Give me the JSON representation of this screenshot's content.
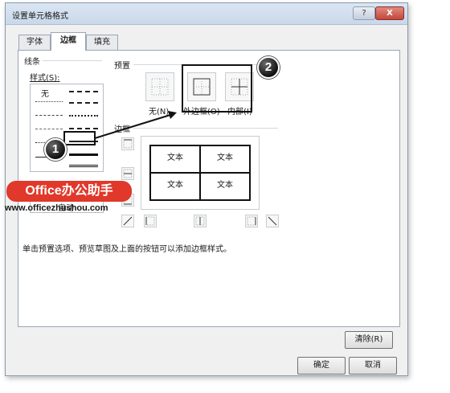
{
  "window": {
    "title": "设置单元格格式",
    "help_label": "?",
    "close_label": "X"
  },
  "tabs": [
    {
      "label": "字体",
      "active": false
    },
    {
      "label": "边框",
      "active": true
    },
    {
      "label": "填充",
      "active": false
    }
  ],
  "line": {
    "group_label": "线条",
    "style_label": "样式(S):",
    "none_label": "无",
    "color_value": "自动"
  },
  "presets": {
    "group_label": "预置",
    "items": [
      {
        "label": "无(N)",
        "icon": "border-none-icon"
      },
      {
        "label": "外边框(O)",
        "icon": "border-outline-icon"
      },
      {
        "label": "内部(I)",
        "icon": "border-inside-icon"
      }
    ]
  },
  "border": {
    "group_label": "边框",
    "preview_cells": [
      "文本",
      "文本",
      "文本",
      "文本"
    ]
  },
  "hint_text": "单击预置选项、预览草图及上面的按钮可以添加边框样式。",
  "buttons": {
    "clear": "清除(R)",
    "ok": "确定",
    "cancel": "取消"
  },
  "callouts": [
    "1",
    "2"
  ],
  "watermark": {
    "brand": "Office办公助手",
    "url": "www.officezhushou.com"
  },
  "colors": {
    "accent": "#e0382a",
    "annotation": "#111111"
  }
}
